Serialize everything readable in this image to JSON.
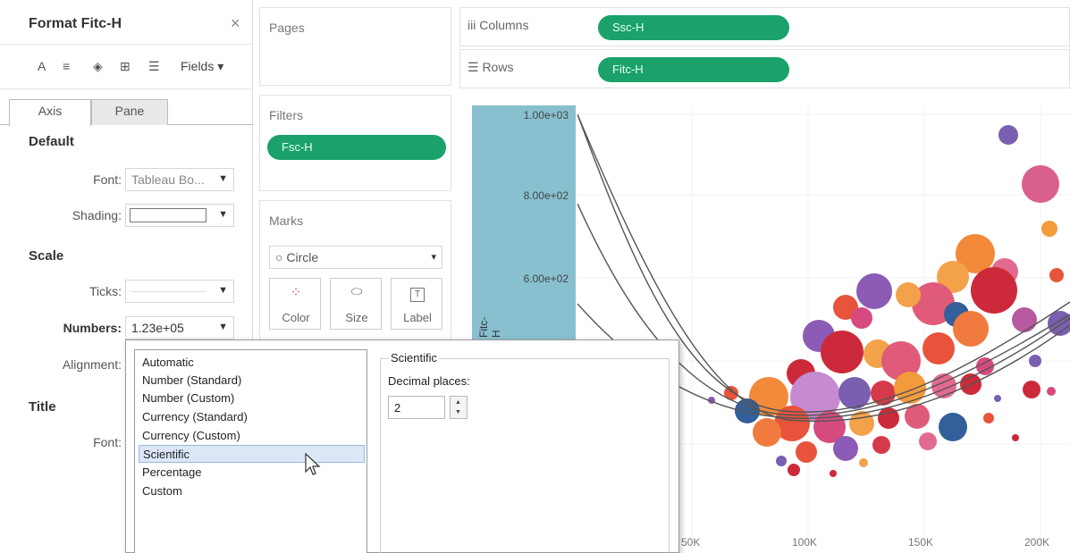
{
  "format_pane": {
    "title": "Format Fitc-H",
    "close_glyph": "×",
    "toolbar": {
      "icons": [
        "font-icon",
        "align-icon",
        "shading-icon",
        "borders-icon",
        "lines-icon"
      ],
      "icon_glyphs": [
        "A",
        "≡",
        "◈",
        "⊞",
        "☰"
      ],
      "fields_label": "Fields ▾"
    },
    "tabs": [
      {
        "label": "Axis",
        "active": true
      },
      {
        "label": "Pane",
        "active": false
      }
    ],
    "default_section": {
      "heading": "Default",
      "font_label": "Font:",
      "font_value": "Tableau Bo...",
      "shading_label": "Shading:"
    },
    "scale_section": {
      "heading": "Scale",
      "ticks_label": "Ticks:",
      "numbers_label": "Numbers:",
      "numbers_value": "1.23e+05",
      "alignment_label": "Alignment:"
    },
    "title_section": {
      "heading": "Title",
      "font_label": "Font:"
    }
  },
  "shelves": {
    "pages_label": "Pages",
    "filters_label": "Filters",
    "filter_pill": "Fsc-H",
    "marks_label": "Marks",
    "mark_type": "○  Circle",
    "mark_buttons": [
      {
        "label": "Color",
        "icon": "color-icon",
        "glyph": "⁘"
      },
      {
        "label": "Size",
        "icon": "size-icon",
        "glyph": "⬭"
      },
      {
        "label": "Label",
        "icon": "label-icon",
        "glyph": "T"
      }
    ]
  },
  "view": {
    "columns_label": "iii  Columns",
    "columns_pill": "Ssc-H",
    "rows_label": "☰  Rows",
    "rows_pill": "Fitc-H",
    "axis_title": "Fitc-H",
    "y_ticks": [
      "1.00e+03",
      "8.00e+02",
      "6.00e+02"
    ],
    "x_ticks": [
      "50K",
      "100K",
      "150K",
      "200K"
    ]
  },
  "number_format_dialog": {
    "options": [
      "Automatic",
      "Number (Standard)",
      "Number (Custom)",
      "Currency (Standard)",
      "Currency (Custom)",
      "Scientific",
      "Percentage",
      "Custom"
    ],
    "selected": "Scientific",
    "group_title": "Scientific",
    "decimal_label": "Decimal places:",
    "decimal_value": "2"
  },
  "colors": {
    "pill_green": "#1aa26a",
    "axis_band": "#88c0d0",
    "selection": "#dbe7f7"
  }
}
